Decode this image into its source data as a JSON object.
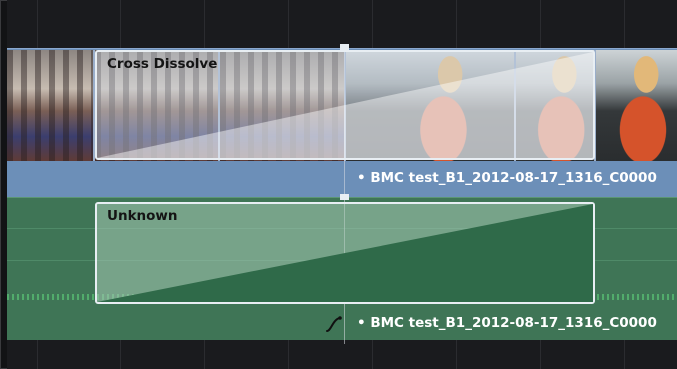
{
  "colors": {
    "video_track": "#6c8fb8",
    "audio_track": "#3f7556",
    "transition_border": "#e8eef3",
    "background": "#1e1f22"
  },
  "video": {
    "transition_name": "Cross Dissolve",
    "clip_name": "• BMC test_B1_2012-08-17_1316_C0000"
  },
  "audio": {
    "transition_name": "Unknown",
    "clip_name": "• BMC test_B1_2012-08-17_1316_C0000",
    "fade_icon": "curve-icon"
  }
}
